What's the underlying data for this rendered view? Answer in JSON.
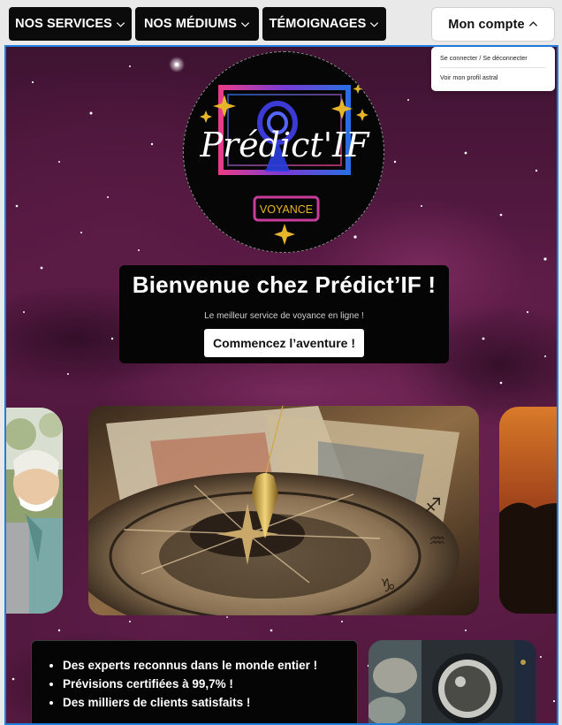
{
  "nav": {
    "services_label": "NOS SERVICES",
    "mediums_label": "NOS MÉDIUMS",
    "testimonials_label": "TÉMOIGNAGES",
    "account_label": "Mon compte"
  },
  "account_menu": {
    "items": [
      {
        "label": "Se connecter / Se déconnecter"
      },
      {
        "label": "Voir mon profil astral"
      }
    ]
  },
  "logo": {
    "brand": "Prédict'IF",
    "tagline": "VOYANCE"
  },
  "hero": {
    "title": "Bienvenue chez Prédict’IF !",
    "subtitle": "Le meilleur service de voyance en ligne !",
    "cta_label": "Commencez l’aventure !"
  },
  "features": {
    "items": [
      "Des experts reconnus dans le monde entier !",
      "Prévisions certifiées à 99,7% !",
      "Des milliers de clients satisfaits !"
    ]
  },
  "colors": {
    "background": "#4e173d",
    "nav_button": "#0b0b0b",
    "frame_border": "#1f7ee0",
    "logo_gold": "#e7b52a",
    "logo_gradient_start": "#e83c8a",
    "logo_gradient_end": "#2a6de0"
  },
  "icons": {
    "nav_chevron": "chevron-down-icon",
    "account_chevron": "chevron-up-icon"
  }
}
